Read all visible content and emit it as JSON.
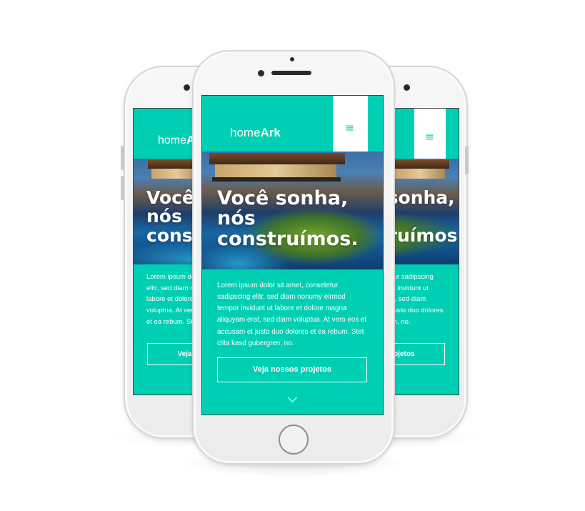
{
  "site": {
    "logo_light": "home",
    "logo_bold": "Ark",
    "menu_icon": "≡",
    "hero_line1": "Você sonha,",
    "hero_line2": "nós",
    "hero_line3": "construímos.",
    "paragraph": "Lorem ipsum dolor sit amet, consetetur sadipscing elitr, sed diam nonumy eirmod tempor invidunt ut labore et dolore magna aliquyam erat, sed diam voluptua. At vero eos et accusam et justo duo dolores et ea rebum. Stet clita kasd gubergren, no.",
    "cta_label": "Veja nossos projetos",
    "scroll_icon": "chevron-down-icon"
  },
  "colors": {
    "brand": "#00cfb4",
    "white": "#ffffff"
  }
}
